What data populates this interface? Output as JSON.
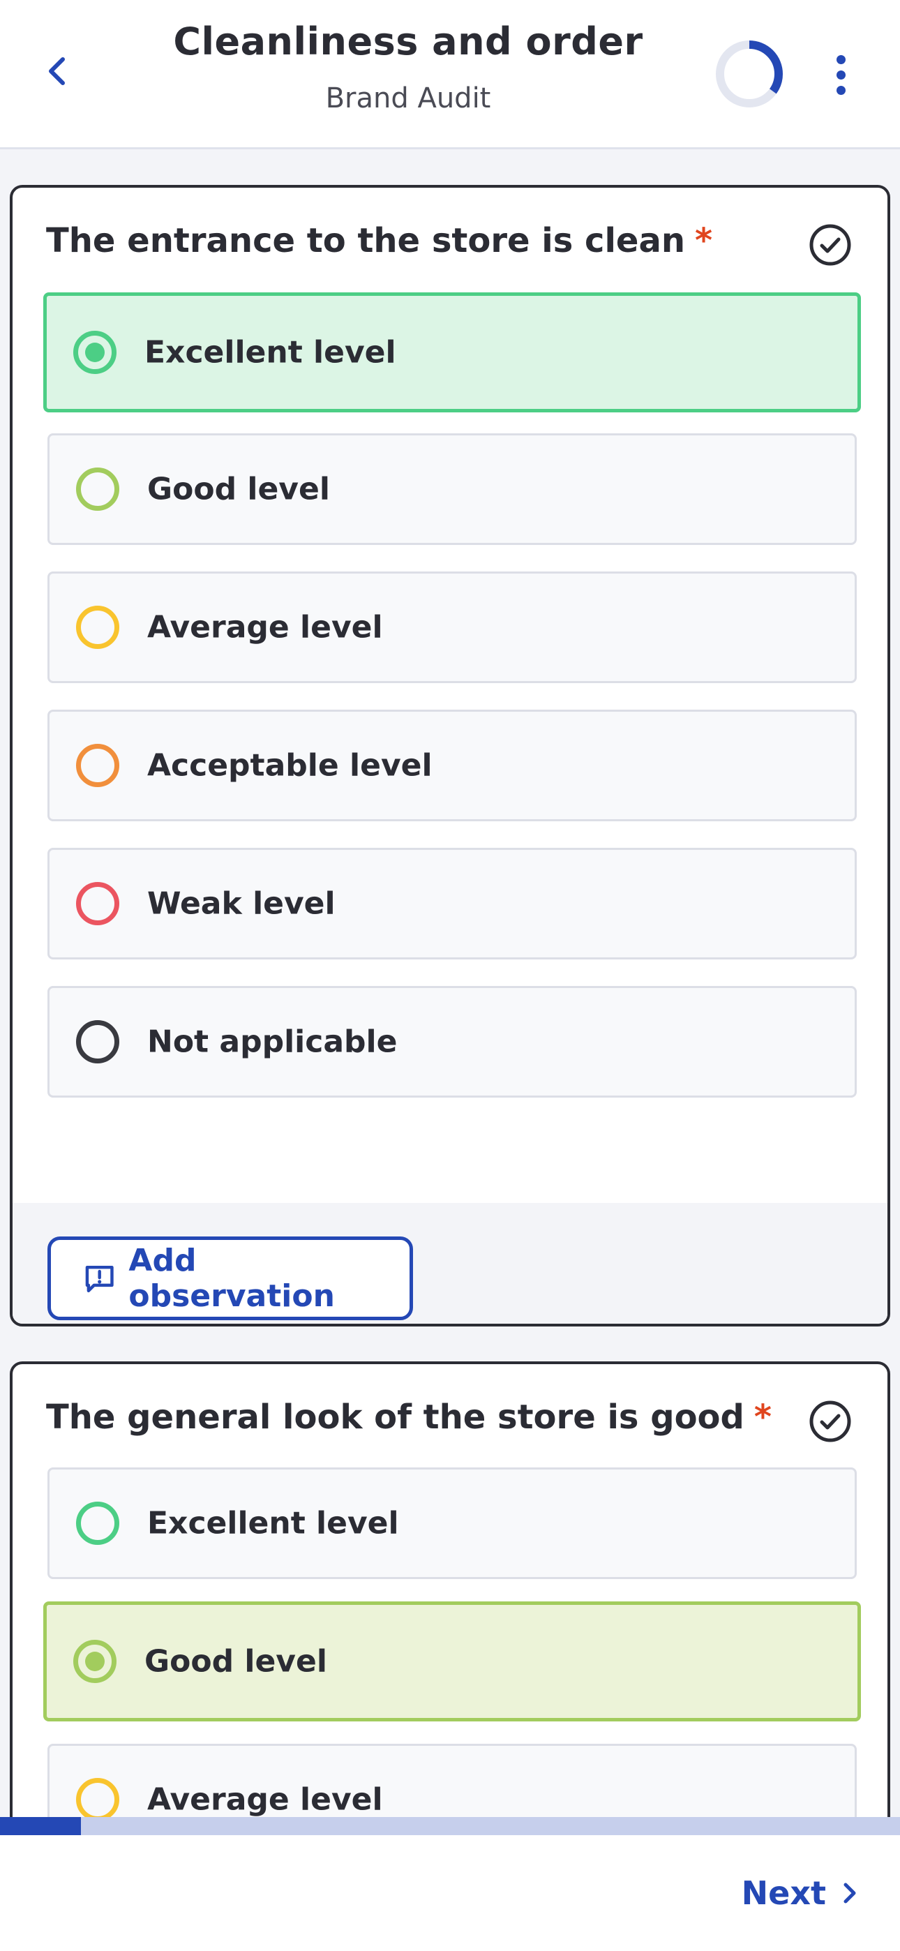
{
  "header": {
    "title": "Cleanliness and order",
    "subtitle": "Brand Audit",
    "progress_fraction": 0.35
  },
  "questions": [
    {
      "text": "The entrance to the store is clean",
      "required_mark": "*",
      "selected": "Excellent level",
      "options": [
        {
          "label": "Excellent level",
          "color": "#4cce85"
        },
        {
          "label": "Good level",
          "color": "#a2cc5d"
        },
        {
          "label": "Average level",
          "color": "#f9c42e"
        },
        {
          "label": "Acceptable level",
          "color": "#f18f3c"
        },
        {
          "label": "Weak level",
          "color": "#eb5560"
        },
        {
          "label": "Not applicable",
          "color": "#393a40"
        }
      ],
      "observation_button": "Add observation"
    },
    {
      "text": "The general look of the store is good",
      "required_mark": "*",
      "selected": "Good level",
      "options": [
        {
          "label": "Excellent level",
          "color": "#4cce85"
        },
        {
          "label": "Good level",
          "color": "#a2cc5d"
        },
        {
          "label": "Average level",
          "color": "#f9c42e"
        }
      ]
    }
  ],
  "footer": {
    "next_label": "Next",
    "page_progress_fraction": 0.09
  },
  "colors": {
    "accent": "#2448b5",
    "required": "#e0451e"
  }
}
